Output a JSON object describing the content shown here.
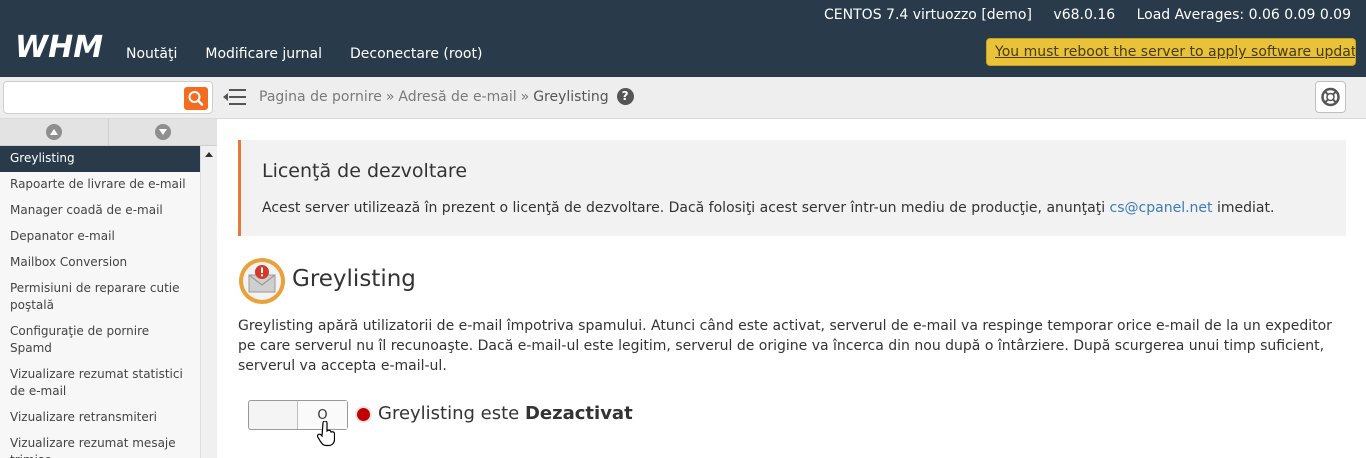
{
  "topbar": {
    "sysinfo": {
      "os": "CENTOS 7.4 virtuozzo [demo]",
      "version": "v68.0.16",
      "load": "Load Averages: 0.06 0.09 0.09"
    },
    "logo_text": "WHM",
    "nav": [
      "Noutăţi",
      "Modificare jurnal",
      "Deconectare (root)"
    ],
    "reboot_notice": "You must reboot the server to apply software updates.",
    "reboot_color": "#e8c33a",
    "bar_color": "#293a4a"
  },
  "search": {
    "value": "",
    "placeholder": "",
    "button_color": "#f26c21"
  },
  "breadcrumb": {
    "items": [
      "Pagina de pornire",
      "Adresă de e-mail",
      "Greylisting"
    ],
    "separator": "»"
  },
  "sidebar": {
    "items": [
      {
        "label": "Greylisting",
        "active": true
      },
      {
        "label": "Rapoarte de livrare de e-mail"
      },
      {
        "label": "Manager coadă de e-mail"
      },
      {
        "label": "Depanator e-mail"
      },
      {
        "label": "Mailbox Conversion"
      },
      {
        "label": "Permisiuni de reparare cutie poştală"
      },
      {
        "label": "Configuraţie de pornire Spamd"
      },
      {
        "label": "Vizualizare rezumat statistici de e-mail"
      },
      {
        "label": "Vizualizare retransmiteri"
      },
      {
        "label": "Vizualizare rezumat mesaje trimise"
      }
    ]
  },
  "license": {
    "title": "Licenţă de dezvoltare",
    "text_before": "Acest server utilizează în prezent o licenţă de dezvoltare. Dacă folosiţi acest server într-un mediu de producţie, anunţaţi ",
    "email": "cs@cpanel.net",
    "text_after": " imediat.",
    "accent": "#e5793a"
  },
  "page": {
    "title": "Greylisting",
    "description": "Greylisting apără utilizatorii de e-mail împotriva spamului. Atunci când este activat, serverul de e-mail va respinge temporar orice e-mail de la un expeditor pe care serverul nu îl recunoaşte. Dacă e-mail-ul este legitim, serverul de origine va încerca din nou după o întârziere. După scurgerea unui timp suficient, serverul va accepta e-mail-ul."
  },
  "toggle": {
    "state_label": "O",
    "enabled": false
  },
  "status": {
    "prefix": "Greylisting este ",
    "value": "Dezactivat",
    "color": "#c20000"
  }
}
